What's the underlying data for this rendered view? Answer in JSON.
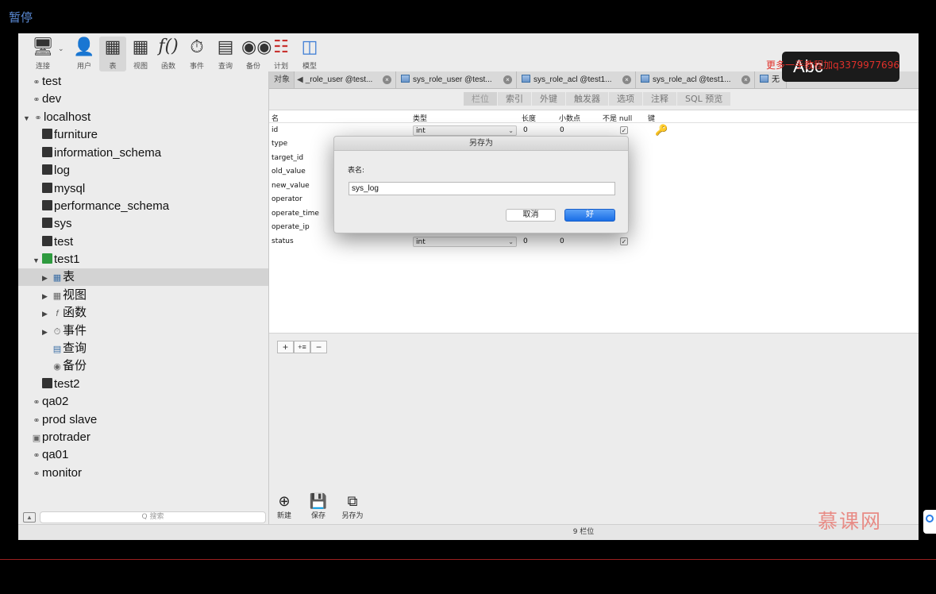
{
  "player": {
    "pause_label": "暂停"
  },
  "toolbar": {
    "items": [
      {
        "label": "连接",
        "icon": "connect-icon"
      },
      {
        "label": "用户",
        "icon": "user-icon"
      },
      {
        "label": "表",
        "icon": "table-icon"
      },
      {
        "label": "视图",
        "icon": "view-icon"
      },
      {
        "label": "函数",
        "icon": "function-icon"
      },
      {
        "label": "事件",
        "icon": "event-icon"
      },
      {
        "label": "查询",
        "icon": "query-icon"
      },
      {
        "label": "备份",
        "icon": "backup-icon"
      },
      {
        "label": "计划",
        "icon": "schedule-icon"
      },
      {
        "label": "模型",
        "icon": "model-icon"
      }
    ]
  },
  "sidebar": {
    "tree": [
      {
        "label": "test",
        "kind": "connection"
      },
      {
        "label": "dev",
        "kind": "connection"
      },
      {
        "label": "localhost",
        "kind": "connection-open"
      },
      {
        "label": "furniture",
        "kind": "database"
      },
      {
        "label": "information_schema",
        "kind": "database"
      },
      {
        "label": "log",
        "kind": "database"
      },
      {
        "label": "mysql",
        "kind": "database"
      },
      {
        "label": "performance_schema",
        "kind": "database"
      },
      {
        "label": "sys",
        "kind": "database"
      },
      {
        "label": "test",
        "kind": "database"
      },
      {
        "label": "test1",
        "kind": "database-open"
      },
      {
        "label": "表",
        "kind": "tables"
      },
      {
        "label": "视图",
        "kind": "views"
      },
      {
        "label": "函数",
        "kind": "functions"
      },
      {
        "label": "事件",
        "kind": "events"
      },
      {
        "label": "查询",
        "kind": "queries"
      },
      {
        "label": "备份",
        "kind": "backups"
      },
      {
        "label": "test2",
        "kind": "database"
      },
      {
        "label": "qa02",
        "kind": "connection"
      },
      {
        "label": "prod slave",
        "kind": "connection"
      },
      {
        "label": "protrader",
        "kind": "connection"
      },
      {
        "label": "qa01",
        "kind": "connection"
      },
      {
        "label": "monitor",
        "kind": "connection"
      }
    ],
    "search_placeholder": "Q 搜索"
  },
  "tabs": {
    "objects_label": "对象",
    "items": [
      {
        "label": "_role_user @test..."
      },
      {
        "label": "sys_role_user @test..."
      },
      {
        "label": "sys_role_acl @test1..."
      },
      {
        "label": "sys_role_acl @test1..."
      },
      {
        "label": "无"
      }
    ]
  },
  "subtabs": [
    "栏位",
    "索引",
    "外键",
    "触发器",
    "选项",
    "注释",
    "SQL 预览"
  ],
  "grid": {
    "headers": {
      "name": "名",
      "type": "类型",
      "length": "长度",
      "decimals": "小数点",
      "not_null": "不是 null",
      "key": "键"
    },
    "rows": [
      {
        "name": "id",
        "type": "int",
        "length": "0",
        "decimals": "0",
        "not_null": true,
        "key": true
      },
      {
        "name": "type"
      },
      {
        "name": "target_id"
      },
      {
        "name": "old_value"
      },
      {
        "name": "new_value"
      },
      {
        "name": "operator"
      },
      {
        "name": "operate_time"
      },
      {
        "name": "operate_ip"
      },
      {
        "name": "status",
        "type": "int",
        "length": "0",
        "decimals": "0",
        "not_null": true
      }
    ]
  },
  "grid_tools": [
    "+",
    "+≡",
    "−"
  ],
  "bottom_tools": [
    {
      "label": "新建",
      "icon": "new-icon"
    },
    {
      "label": "保存",
      "icon": "save-icon"
    },
    {
      "label": "另存为",
      "icon": "save-as-icon"
    }
  ],
  "status": {
    "fields_count": "9 栏位"
  },
  "dialog": {
    "title": "另存为",
    "label": "表名:",
    "value": "sys_log",
    "cancel": "取消",
    "ok": "好"
  },
  "overlay": {
    "ime": "Abc",
    "watermark": "更多一手教程加q3379977696",
    "brand": "慕课网"
  },
  "colors": {
    "accent": "#1a6ee6",
    "watermark": "#e0302a",
    "pause_label": "#5b8bd6"
  }
}
